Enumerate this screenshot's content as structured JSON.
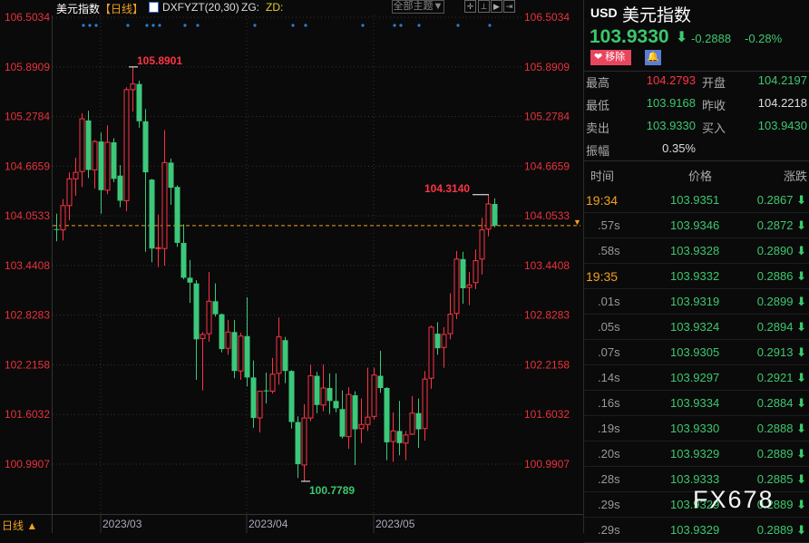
{
  "topbar": {
    "title": "美元指数",
    "period": "【日线】",
    "indicator": "DXFYZT(20,30)",
    "zg": "ZG:",
    "zd": "ZD:",
    "theme_button": "全部主题▼",
    "icons": [
      "crosshair-icon",
      "range-icon",
      "play-icon",
      "exit-icon"
    ]
  },
  "axis": {
    "price_labels": [
      "106.5034",
      "105.8909",
      "105.2784",
      "104.6659",
      "104.0533",
      "103.4408",
      "102.8283",
      "102.2158",
      "101.6032",
      "100.9907"
    ],
    "date_labels": [
      "2023/03",
      "2023/04",
      "2023/05"
    ],
    "period_label": "日线"
  },
  "chart_data": {
    "type": "candlestick",
    "ylim": [
      100.9907,
      106.5034
    ],
    "current_price": 103.933,
    "annotations": {
      "high": "105.8901",
      "low": "100.7789",
      "recent_high": "104.3140"
    },
    "colors": {
      "up": "#ff3344",
      "down": "#3cc87a",
      "current_line": "#f0a020"
    },
    "ohlc": [
      [
        103.89,
        104.08,
        103.74,
        103.88
      ],
      [
        103.88,
        104.26,
        103.75,
        104.18
      ],
      [
        104.18,
        104.59,
        104.0,
        104.51
      ],
      [
        104.51,
        104.77,
        104.3,
        104.59
      ],
      [
        104.6,
        105.32,
        104.41,
        105.25
      ],
      [
        105.23,
        105.35,
        104.52,
        104.62
      ],
      [
        104.62,
        104.99,
        104.39,
        104.97
      ],
      [
        104.97,
        105.08,
        104.08,
        104.37
      ],
      [
        104.37,
        105.17,
        104.32,
        104.96
      ],
      [
        104.96,
        105.01,
        104.47,
        104.51
      ],
      [
        104.55,
        104.68,
        104.16,
        104.24
      ],
      [
        104.24,
        105.64,
        104.11,
        105.61
      ],
      [
        105.61,
        105.8901,
        105.34,
        105.68
      ],
      [
        105.68,
        105.72,
        105.14,
        105.22
      ],
      [
        105.22,
        105.37,
        103.61,
        104.59
      ],
      [
        104.5,
        104.51,
        103.48,
        103.65
      ],
      [
        103.65,
        104.07,
        103.42,
        103.66
      ],
      [
        103.65,
        105.11,
        103.44,
        104.71
      ],
      [
        104.71,
        104.76,
        104.19,
        104.4
      ],
      [
        104.41,
        104.43,
        103.67,
        103.72
      ],
      [
        103.72,
        103.95,
        103.27,
        103.29
      ],
      [
        103.29,
        103.51,
        102.98,
        103.23
      ],
      [
        103.22,
        103.26,
        102.03,
        102.53
      ],
      [
        102.54,
        102.62,
        101.9,
        102.59
      ],
      [
        102.6,
        103.36,
        102.5,
        103.0
      ],
      [
        103.0,
        103.22,
        102.81,
        102.84
      ],
      [
        102.84,
        102.85,
        102.37,
        102.41
      ],
      [
        102.42,
        102.77,
        102.34,
        102.62
      ],
      [
        102.62,
        102.77,
        102.05,
        102.14
      ],
      [
        102.14,
        102.61,
        102.03,
        102.57
      ],
      [
        102.57,
        103.05,
        101.95,
        102.06
      ],
      [
        102.06,
        102.27,
        101.44,
        101.56
      ],
      [
        101.56,
        101.89,
        101.38,
        101.89
      ],
      [
        101.9,
        102.12,
        101.74,
        101.89
      ],
      [
        101.89,
        102.3,
        101.86,
        102.1
      ],
      [
        102.11,
        102.8,
        101.97,
        102.56
      ],
      [
        102.52,
        102.56,
        101.99,
        102.14
      ],
      [
        102.14,
        102.15,
        101.43,
        101.51
      ],
      [
        101.51,
        101.58,
        100.82,
        100.99
      ],
      [
        100.98,
        101.73,
        100.7789,
        101.56
      ],
      [
        101.56,
        102.22,
        101.52,
        102.08
      ],
      [
        102.08,
        102.13,
        101.62,
        101.72
      ],
      [
        101.72,
        102.22,
        101.64,
        101.93
      ],
      [
        101.93,
        102.11,
        101.61,
        101.77
      ],
      [
        101.77,
        102.11,
        101.63,
        101.68
      ],
      [
        101.67,
        101.9,
        101.31,
        101.33
      ],
      [
        101.33,
        101.94,
        101.18,
        101.85
      ],
      [
        101.84,
        101.89,
        100.98,
        101.42
      ],
      [
        101.43,
        101.8,
        101.25,
        101.48
      ],
      [
        101.48,
        102.18,
        101.4,
        101.57
      ],
      [
        101.58,
        102.18,
        101.54,
        102.09
      ],
      [
        102.08,
        102.39,
        101.87,
        101.93
      ],
      [
        101.93,
        101.94,
        101.04,
        101.26
      ],
      [
        101.27,
        101.63,
        101.02,
        101.4
      ],
      [
        101.4,
        101.77,
        101.1,
        101.25
      ],
      [
        101.25,
        101.4,
        101.04,
        101.35
      ],
      [
        101.36,
        101.83,
        101.35,
        101.62
      ],
      [
        101.62,
        101.8,
        101.19,
        101.42
      ],
      [
        101.43,
        102.14,
        101.28,
        102.04
      ],
      [
        102.05,
        102.7,
        101.92,
        102.68
      ],
      [
        102.6,
        102.74,
        102.34,
        102.42
      ],
      [
        102.43,
        102.68,
        102.18,
        102.59
      ],
      [
        102.6,
        103.1,
        102.53,
        102.84
      ],
      [
        102.85,
        103.62,
        102.78,
        103.52
      ],
      [
        103.52,
        103.61,
        102.97,
        103.16
      ],
      [
        103.17,
        103.36,
        102.95,
        103.2
      ],
      [
        103.23,
        103.64,
        103.15,
        103.5
      ],
      [
        103.52,
        104.03,
        103.33,
        103.88
      ],
      [
        103.89,
        104.314,
        103.8,
        104.2
      ],
      [
        104.2,
        104.27,
        103.91,
        103.933
      ]
    ]
  },
  "quote": {
    "code": "USD",
    "name": "美元指数",
    "price": "103.9330",
    "change": "-0.2888",
    "change_pct": "-0.28%",
    "remove_button": "移除",
    "green": "#3cc86e",
    "red": "#ff3344"
  },
  "stats": [
    {
      "k1": "最高",
      "v1": "104.2793",
      "c1": "red",
      "k2": "开盘",
      "v2": "104.2197",
      "c2": "green"
    },
    {
      "k1": "最低",
      "v1": "103.9168",
      "c1": "green",
      "k2": "昨收",
      "v2": "104.2218",
      "c2": "white"
    },
    {
      "k1": "卖出",
      "v1": "103.9330",
      "c1": "green",
      "k2": "买入",
      "v2": "103.9430",
      "c2": "green"
    },
    {
      "k1": "振幅",
      "v1": "0.35%",
      "c1": "white"
    }
  ],
  "ticks_header": {
    "time": "时间",
    "price": "价格",
    "change": "涨跌"
  },
  "ticks": [
    {
      "t": "19:34",
      "p": "103.9351",
      "c": "0.2867"
    },
    {
      "t": ".57s",
      "p": "103.9346",
      "c": "0.2872"
    },
    {
      "t": ".58s",
      "p": "103.9328",
      "c": "0.2890"
    },
    {
      "t": "19:35",
      "p": "103.9332",
      "c": "0.2886"
    },
    {
      "t": ".01s",
      "p": "103.9319",
      "c": "0.2899"
    },
    {
      "t": ".05s",
      "p": "103.9324",
      "c": "0.2894"
    },
    {
      "t": ".07s",
      "p": "103.9305",
      "c": "0.2913"
    },
    {
      "t": ".14s",
      "p": "103.9297",
      "c": "0.2921"
    },
    {
      "t": ".16s",
      "p": "103.9334",
      "c": "0.2884"
    },
    {
      "t": ".19s",
      "p": "103.9330",
      "c": "0.2888"
    },
    {
      "t": ".20s",
      "p": "103.9329",
      "c": "0.2889"
    },
    {
      "t": ".28s",
      "p": "103.9333",
      "c": "0.2885"
    },
    {
      "t": ".29s",
      "p": "103.9329",
      "c": "0.2889"
    },
    {
      "t": ".29s",
      "p": "103.9329",
      "c": "0.2889"
    }
  ],
  "watermark": "FX678"
}
